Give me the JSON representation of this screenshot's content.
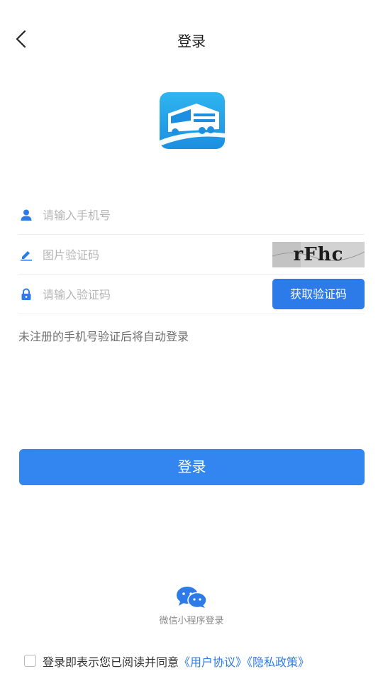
{
  "header": {
    "title": "登录"
  },
  "form": {
    "phone": {
      "placeholder": "请输入手机号",
      "value": ""
    },
    "image_code": {
      "placeholder": "图片验证码",
      "value": "",
      "captcha_text": "rFhc"
    },
    "sms_code": {
      "placeholder": "请输入验证码",
      "value": "",
      "button_label": "获取验证码"
    },
    "hint": "未注册的手机号验证后将自动登录"
  },
  "login_button": {
    "label": "登录"
  },
  "wechat": {
    "label": "微信小程序登录"
  },
  "agreement": {
    "text": "登录即表示您已阅读并同意",
    "user_agreement": "《用户协议》",
    "privacy_policy": "《隐私政策》"
  },
  "colors": {
    "primary": "#3385f0",
    "icon_blue": "#2c7be8",
    "wechat_blue": "#2c7be8"
  },
  "icons": [
    "back-arrow",
    "user",
    "pencil",
    "lock",
    "wechat"
  ]
}
